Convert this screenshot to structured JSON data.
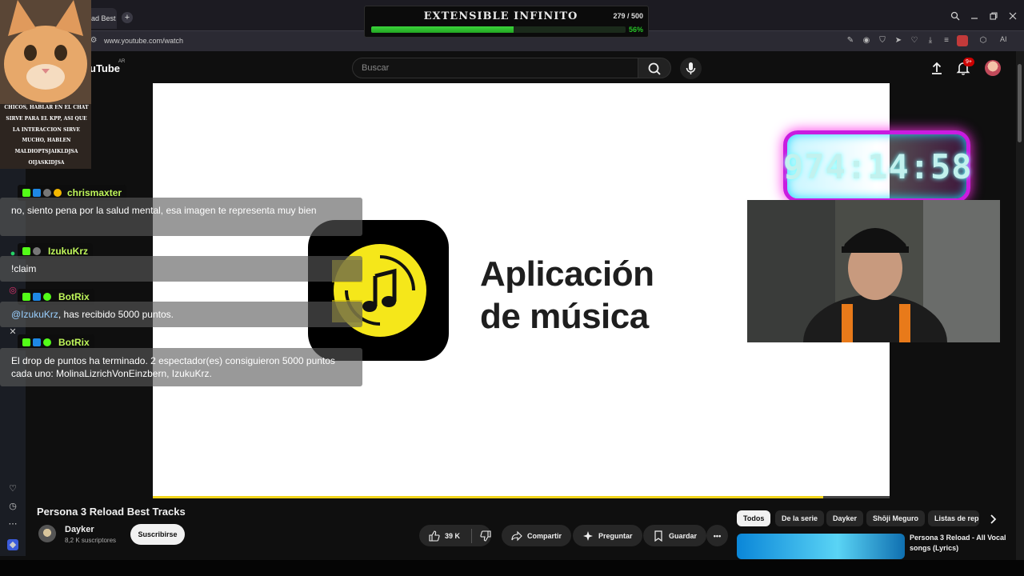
{
  "browser": {
    "tab_title": "ad Best",
    "new_tab": "+",
    "url": "www.youtube.com/watch",
    "ai_button": "AI"
  },
  "goal_overlay": {
    "title": "EXTENSIBLE INFINITO",
    "count": "279 / 500",
    "percent_label": "56%",
    "progress": 0.56
  },
  "youtube": {
    "logo": "uTube",
    "logo_sup": "AR",
    "search_placeholder": "Buscar",
    "notifications": "9+"
  },
  "cat_overlay": {
    "caption": "Chicos, hablar en el chat sirve para el KPP, asi que la interaccion sirve mucho, hablen maldioptsjaikldjsa oijaskidjsa"
  },
  "timer": {
    "value": "974:14:58"
  },
  "video": {
    "slide_title_line1": "Aplicación",
    "slide_title_line2": "de música",
    "progress": 0.91
  },
  "chat": {
    "messages": [
      {
        "user": "chrismaxter",
        "text": "no, siento pena por la salud mental, esa imagen te representa muy bien"
      },
      {
        "user": "IzukuKrz",
        "text": "!claim"
      },
      {
        "user": "BotRix",
        "mention": "@IzukuKrz",
        "text": ", has recibido 5000 puntos."
      },
      {
        "user": "BotRix",
        "text": "El drop de puntos ha terminado. 2 espectador(es) consiguieron 5000 puntos cada uno: MolinaLizrichVonEinzbern, IzukuKrz."
      }
    ]
  },
  "watch": {
    "title": "Persona 3 Reload Best Tracks",
    "channel": "Dayker",
    "subscribers": "8,2 K suscriptores",
    "subscribe": "Suscribirse",
    "likes": "39 K",
    "share": "Compartir",
    "ask": "Preguntar",
    "save": "Guardar",
    "more": "•••"
  },
  "chips": [
    "Todos",
    "De la serie",
    "Dayker",
    "Shōji Meguro",
    "Listas de rep"
  ],
  "recommendation": {
    "title": "Persona 3 Reload - All Vocal songs (Lyrics)"
  },
  "colors": {
    "accent_yellow": "#f2d51b",
    "chat_name": "#bff65a",
    "timer_glow": "#ff2fe8",
    "goal_green": "#27c227"
  }
}
